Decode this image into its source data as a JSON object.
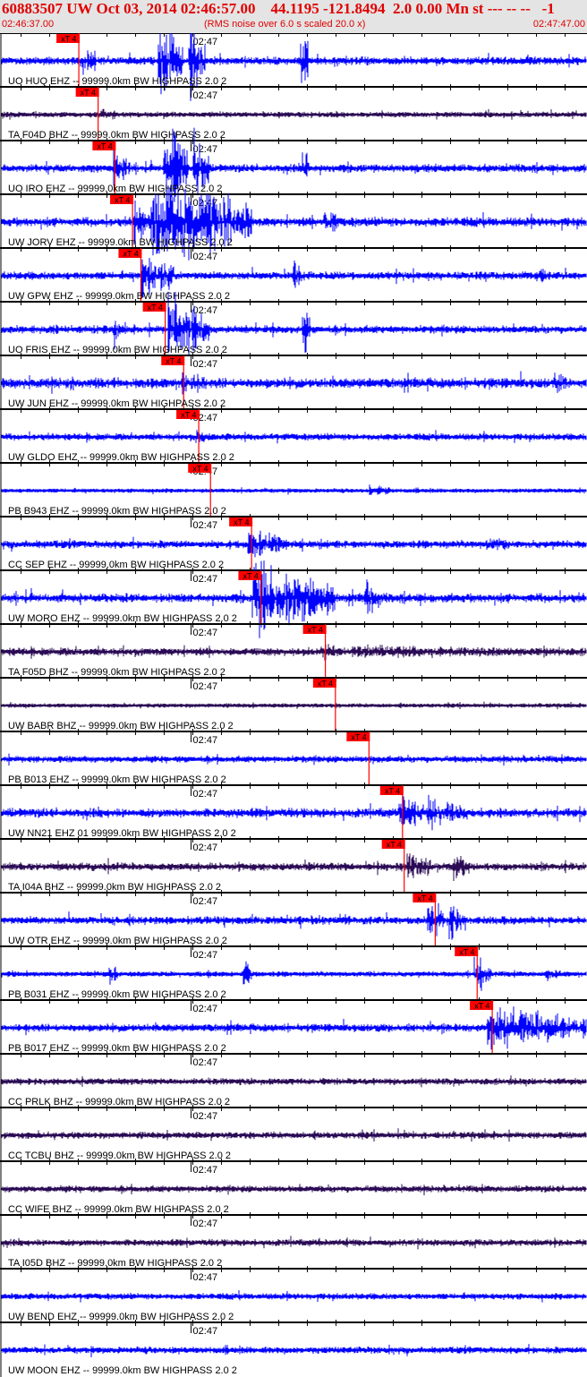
{
  "header": {
    "title": "60883507 UW Oct 03, 2014 02:46:57.00    44.1195 -121.8494  2.0 0.00 Mn st --- -- --   -1",
    "start_time": "02:46:37.00",
    "note": "(RMS noise over 6.0 s scaled 20.0 x)",
    "end_time": "02:47:47.00"
  },
  "chart_data": {
    "type": "line",
    "title": "60883507 UW Oct 03, 2014 02:46:57.00",
    "x_range_seconds": [
      0,
      70
    ],
    "tick_label": "02:47",
    "tick_label_seconds": 23,
    "pick_label": "xT 4",
    "colors": {
      "ehz": "#0000ff",
      "bhz": "#2a0a55",
      "pick": "#ff0000",
      "axis": "#000000"
    },
    "traces": [
      {
        "label": "UO HUQ EHZ -- 99999.0km BW  HIGHPASS  2.0  2",
        "pick": 9.4,
        "noise": 0.25,
        "color": "ehz",
        "events": [
          [
            9.5,
            1.5,
            2
          ],
          [
            18.8,
            4,
            3
          ],
          [
            22.5,
            3,
            2
          ],
          [
            35.8,
            3,
            1
          ]
        ]
      },
      {
        "label": "TA F04D BHZ -- 99999.0km BW  HIGHPASS  2.0  2",
        "pick": 11.7,
        "noise": 0.15,
        "color": "bhz",
        "events": [
          [
            12,
            0.6,
            2
          ]
        ]
      },
      {
        "label": "UO IRO EHZ -- 99999.0km BW  HIGHPASS  2.0  2",
        "pick": 13.7,
        "noise": 0.25,
        "color": "ehz",
        "events": [
          [
            13.5,
            1.5,
            2
          ],
          [
            19.5,
            4,
            3
          ],
          [
            23,
            3,
            2
          ],
          [
            36,
            2,
            1
          ]
        ]
      },
      {
        "label": "UW JORV EHZ -- 99999.0km BW  HIGHPASS  2.0  2",
        "pick": 15.8,
        "noise": 0.3,
        "color": "ehz",
        "events": [
          [
            16,
            2,
            2
          ],
          [
            18,
            4,
            12
          ],
          [
            38.5,
            1.2,
            2
          ]
        ]
      },
      {
        "label": "UW GPW EHZ -- 99999.0km BW  HIGHPASS  2.0  2",
        "pick": 16.8,
        "noise": 0.25,
        "color": "ehz",
        "events": [
          [
            16.8,
            2,
            4
          ],
          [
            35,
            1.2,
            1
          ],
          [
            64,
            1,
            1
          ]
        ]
      },
      {
        "label": "UO FRIS EHZ -- 99999.0km BW  HIGHPASS  2.0  2",
        "pick": 19.7,
        "noise": 0.25,
        "color": "ehz",
        "events": [
          [
            13.5,
            1.5,
            1
          ],
          [
            20,
            4,
            3
          ],
          [
            23,
            2,
            2
          ],
          [
            36,
            3,
            1
          ]
        ]
      },
      {
        "label": "UW JUN EHZ -- 99999.0km BW  HIGHPASS  2.0  2",
        "pick": 21.9,
        "noise": 0.35,
        "color": "ehz",
        "events": [
          [
            8,
            0.8,
            1
          ],
          [
            21.5,
            1.2,
            3
          ],
          [
            66,
            0.8,
            2
          ]
        ]
      },
      {
        "label": "UW GLDO EHZ -- 99999.0km BW  HIGHPASS  2.0  2",
        "pick": 23.7,
        "noise": 0.2,
        "color": "ehz",
        "events": [
          [
            23.3,
            0.6,
            2
          ]
        ]
      },
      {
        "label": "PB B943 EHZ -- 99999.0km BW  HIGHPASS  2.0  2",
        "pick": 25.1,
        "noise": 0.1,
        "color": "ehz",
        "events": [
          [
            44,
            0.4,
            3
          ]
        ]
      },
      {
        "label": "CC SEP EHZ -- 99999.0km BW  HIGHPASS  2.0  2",
        "pick": 30.0,
        "noise": 0.25,
        "color": "ehz",
        "events": [
          [
            29.5,
            1.3,
            5
          ],
          [
            58,
            0.6,
            3
          ]
        ]
      },
      {
        "label": "UW MORO EHZ -- 99999.0km BW  HIGHPASS  2.0  2",
        "pick": 31.1,
        "noise": 0.3,
        "color": "ehz",
        "events": [
          [
            30,
            3,
            10
          ],
          [
            43.5,
            1.5,
            2
          ]
        ]
      },
      {
        "label": "TA F05D BHZ -- 99999.0km BW  HIGHPASS  2.0  2",
        "pick": 38.8,
        "noise": 0.25,
        "color": "bhz",
        "events": [
          [
            38.5,
            0.8,
            2
          ],
          [
            42,
            0.5,
            25
          ]
        ]
      },
      {
        "label": "UW BABR BHZ -- 99999.0km BW  HIGHPASS  2.0  2",
        "pick": 40.0,
        "noise": 0.1,
        "color": "bhz",
        "events": []
      },
      {
        "label": "PB B013 EHZ -- 99999.0km BW  HIGHPASS  2.0  2",
        "pick": 44.0,
        "noise": 0.2,
        "color": "ehz",
        "events": [
          [
            44,
            0.4,
            3
          ]
        ]
      },
      {
        "label": "UW NN21 EHZ 01 99999.0km BW  HIGHPASS  2.0  2",
        "pick": 48.0,
        "noise": 0.3,
        "color": "ehz",
        "events": [
          [
            47.5,
            1.5,
            3
          ],
          [
            51,
            1.2,
            5
          ]
        ]
      },
      {
        "label": "TA I04A BHZ -- 99999.0km BW  HIGHPASS  2.0  2",
        "pick": 48.2,
        "noise": 0.25,
        "color": "bhz",
        "events": [
          [
            48.5,
            1.3,
            3
          ],
          [
            54,
            1.5,
            2
          ]
        ]
      },
      {
        "label": "UW OTR EHZ -- 99999.0km BW  HIGHPASS  2.0  2",
        "pick": 51.9,
        "noise": 0.25,
        "color": "ehz",
        "events": [
          [
            51,
            2,
            2
          ],
          [
            53.5,
            1.8,
            2
          ]
        ]
      },
      {
        "label": "PB B031 EHZ -- 99999.0km BW  HIGHPASS  2.0  2",
        "pick": 56.9,
        "noise": 0.15,
        "color": "ehz",
        "events": [
          [
            13,
            1,
            1
          ],
          [
            29,
            1.5,
            1
          ],
          [
            56.5,
            1.5,
            2
          ],
          [
            65,
            0.5,
            2
          ]
        ]
      },
      {
        "label": "PB B017 EHZ -- 99999.0km BW  HIGHPASS  2.0  2",
        "pick": 58.7,
        "noise": 0.25,
        "color": "ehz",
        "events": [
          [
            58,
            1.8,
            12
          ]
        ]
      },
      {
        "label": "CC PRLK BHZ -- 99999.0km BW  HIGHPASS  2.0  2",
        "noise": 0.2,
        "color": "bhz",
        "events": []
      },
      {
        "label": "CC TCBU BHZ -- 99999.0km BW  HIGHPASS  2.0  2",
        "noise": 0.2,
        "color": "bhz",
        "events": []
      },
      {
        "label": "CC WIFE BHZ -- 99999.0km BW  HIGHPASS  2.0  2",
        "noise": 0.2,
        "color": "bhz",
        "events": []
      },
      {
        "label": "TA I05D BHZ -- 99999.0km BW  HIGHPASS  2.0  2",
        "noise": 0.2,
        "color": "bhz",
        "events": []
      },
      {
        "label": "UW BEND EHZ -- 99999.0km BW  HIGHPASS  2.0  2",
        "noise": 0.18,
        "color": "ehz",
        "events": []
      },
      {
        "label": "UW MOON EHZ -- 99999.0km BW  HIGHPASS  2.0  2",
        "noise": 0.2,
        "color": "ehz",
        "events": []
      }
    ]
  }
}
